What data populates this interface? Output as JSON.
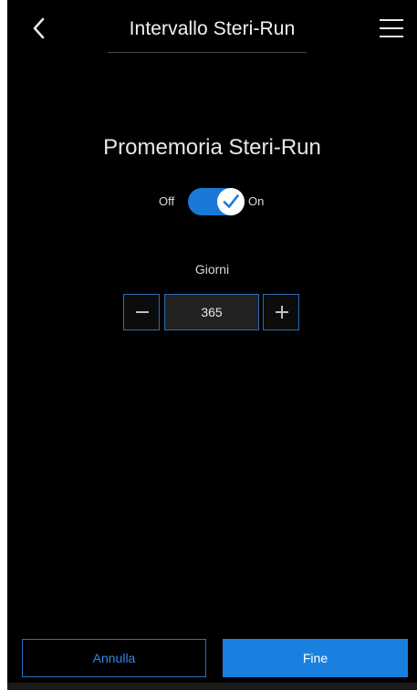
{
  "header": {
    "title": "Intervallo Steri-Run",
    "back_icon": "chevron-left-icon",
    "menu_icon": "hamburger-menu-icon"
  },
  "reminder": {
    "title": "Promemoria Steri-Run",
    "toggle": {
      "off_label": "Off",
      "on_label": "On",
      "state": "on",
      "icon": "checkmark-icon"
    },
    "days": {
      "label": "Giorni",
      "value": "365",
      "minus_icon": "minus-icon",
      "plus_icon": "plus-icon"
    }
  },
  "footer": {
    "cancel_label": "Annulla",
    "done_label": "Fine"
  },
  "colors": {
    "background": "#000000",
    "accent": "#1a80e0",
    "toggle_on": "#1a79d6",
    "stepper_border": "#2b6cae"
  }
}
